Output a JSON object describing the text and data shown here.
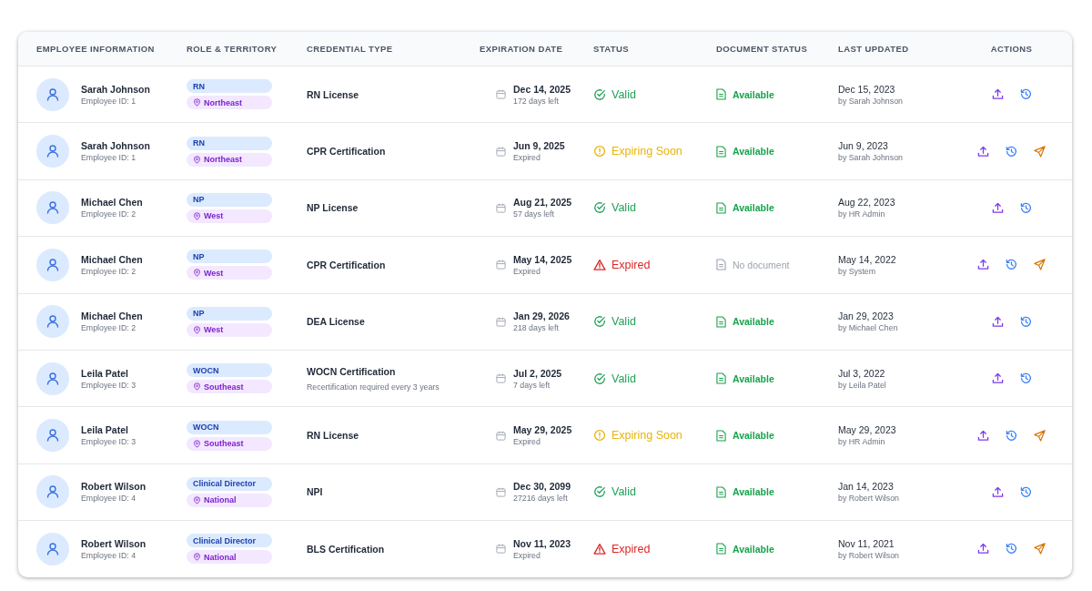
{
  "table": {
    "columns": [
      "EMPLOYEE INFORMATION",
      "ROLE & TERRITORY",
      "CREDENTIAL TYPE",
      "EXPIRATION DATE",
      "STATUS",
      "DOCUMENT STATUS",
      "LAST UPDATED",
      "ACTIONS"
    ],
    "rows": [
      {
        "name": "Sarah Johnson",
        "employee_id": "Employee ID: 1",
        "role": "RN",
        "territory": "Northeast",
        "credential": "RN License",
        "expiration": "Dec 14, 2025",
        "remaining": "172 days left",
        "status": {
          "kind": "valid",
          "label": "Valid"
        },
        "document": {
          "kind": "available",
          "label": "Available"
        },
        "updated": "Dec 15, 2023",
        "updated_by": "by Sarah Johnson",
        "send_reminder": false
      },
      {
        "name": "Sarah Johnson",
        "employee_id": "Employee ID: 1",
        "role": "RN",
        "territory": "Northeast",
        "credential": "CPR Certification",
        "expiration": "Jun 9, 2025",
        "remaining": "Expired",
        "status": {
          "kind": "expiring",
          "label": "Expiring Soon"
        },
        "document": {
          "kind": "available",
          "label": "Available"
        },
        "updated": "Jun 9, 2023",
        "updated_by": "by Sarah Johnson",
        "send_reminder": true
      },
      {
        "name": "Michael Chen",
        "employee_id": "Employee ID: 2",
        "role": "NP",
        "territory": "West",
        "credential": "NP License",
        "expiration": "Aug 21, 2025",
        "remaining": "57 days left",
        "status": {
          "kind": "valid",
          "label": "Valid"
        },
        "document": {
          "kind": "available",
          "label": "Available"
        },
        "updated": "Aug 22, 2023",
        "updated_by": "by HR Admin",
        "send_reminder": false
      },
      {
        "name": "Michael Chen",
        "employee_id": "Employee ID: 2",
        "role": "NP",
        "territory": "West",
        "credential": "CPR Certification",
        "expiration": "May 14, 2025",
        "remaining": "Expired",
        "status": {
          "kind": "expired",
          "label": "Expired"
        },
        "document": {
          "kind": "none",
          "label": "No document"
        },
        "updated": "May 14, 2022",
        "updated_by": "by System",
        "send_reminder": true
      },
      {
        "name": "Michael Chen",
        "employee_id": "Employee ID: 2",
        "role": "NP",
        "territory": "West",
        "credential": "DEA License",
        "expiration": "Jan 29, 2026",
        "remaining": "218 days left",
        "status": {
          "kind": "valid",
          "label": "Valid"
        },
        "document": {
          "kind": "available",
          "label": "Available"
        },
        "updated": "Jan 29, 2023",
        "updated_by": "by Michael Chen",
        "send_reminder": false
      },
      {
        "name": "Leila Patel",
        "employee_id": "Employee ID: 3",
        "role": "WOCN",
        "territory": "Southeast",
        "credential": "WOCN Certification",
        "credential_note": "Recertification required every 3 years",
        "expiration": "Jul 2, 2025",
        "remaining": "7 days left",
        "status": {
          "kind": "valid",
          "label": "Valid"
        },
        "document": {
          "kind": "available",
          "label": "Available"
        },
        "updated": "Jul 3, 2022",
        "updated_by": "by Leila Patel",
        "send_reminder": false
      },
      {
        "name": "Leila Patel",
        "employee_id": "Employee ID: 3",
        "role": "WOCN",
        "territory": "Southeast",
        "credential": "RN License",
        "expiration": "May 29, 2025",
        "remaining": "Expired",
        "status": {
          "kind": "expiring",
          "label": "Expiring Soon"
        },
        "document": {
          "kind": "available",
          "label": "Available"
        },
        "updated": "May 29, 2023",
        "updated_by": "by HR Admin",
        "send_reminder": true
      },
      {
        "name": "Robert Wilson",
        "employee_id": "Employee ID: 4",
        "role": "Clinical Director",
        "territory": "National",
        "credential": "NPI",
        "expiration": "Dec 30, 2099",
        "remaining": "27216 days left",
        "status": {
          "kind": "valid",
          "label": "Valid"
        },
        "document": {
          "kind": "available",
          "label": "Available"
        },
        "updated": "Jan 14, 2023",
        "updated_by": "by Robert Wilson",
        "send_reminder": false
      },
      {
        "name": "Robert Wilson",
        "employee_id": "Employee ID: 4",
        "role": "Clinical Director",
        "territory": "National",
        "credential": "BLS Certification",
        "expiration": "Nov 11, 2023",
        "remaining": "Expired",
        "status": {
          "kind": "expired",
          "label": "Expired"
        },
        "document": {
          "kind": "available",
          "label": "Available"
        },
        "updated": "Nov 11, 2021",
        "updated_by": "by Robert Wilson",
        "send_reminder": true
      }
    ]
  }
}
